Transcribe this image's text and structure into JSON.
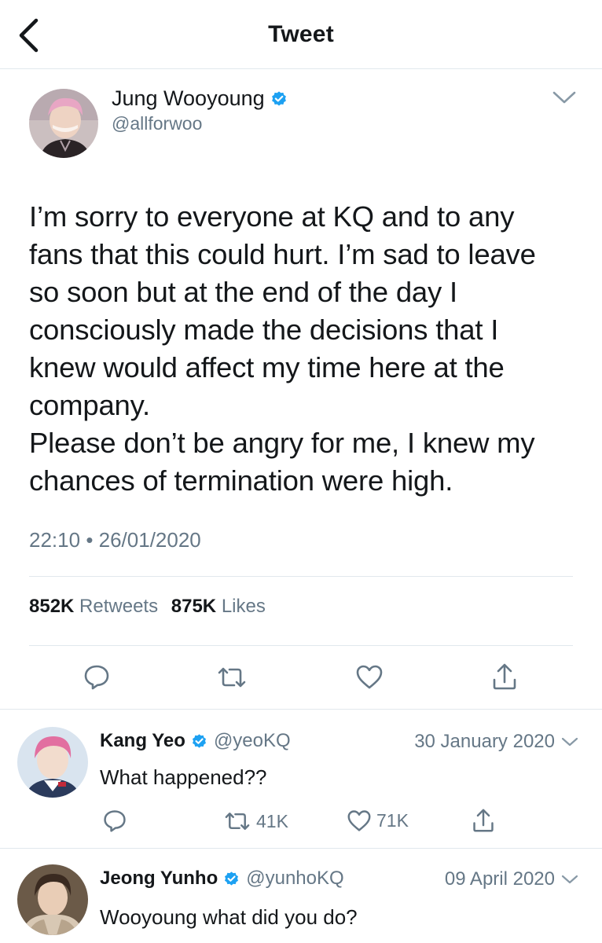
{
  "header": {
    "title": "Tweet",
    "back_icon": "chevron-left-icon"
  },
  "main_tweet": {
    "author_name": "Jung Wooyoung",
    "author_handle": "@allforwoo",
    "verified": true,
    "text": "I’m sorry to everyone at KQ and to any\nfans that this could hurt. I’m sad to leave\nso soon but at the end of the day I\nconsciously made the decisions that I\nknew would affect my time here at the\ncompany.\nPlease don’t be angry for me, I knew my\nchances of termination were high.",
    "time": "22:10",
    "date": "26/01/2020",
    "retweets_count": "852K",
    "retweets_label": "Retweets",
    "likes_count": "875K",
    "likes_label": "Likes",
    "actions": [
      "reply-icon",
      "retweet-icon",
      "like-icon",
      "share-icon"
    ]
  },
  "replies": [
    {
      "name": "Kang Yeo",
      "handle": "@yeoKQ",
      "date": "30 January 2020",
      "text": "What happened??",
      "retweets": "41K",
      "likes": "71K",
      "verified": true
    },
    {
      "name": "Jeong Yunho",
      "handle": "@yunhoKQ",
      "date": "09 April 2020",
      "text": "Wooyoung what did you do?",
      "verified": true
    }
  ],
  "colors": {
    "accent": "#1da1f2",
    "text_primary": "#14171a",
    "text_secondary": "#657786",
    "divider": "#e1e8ed"
  }
}
